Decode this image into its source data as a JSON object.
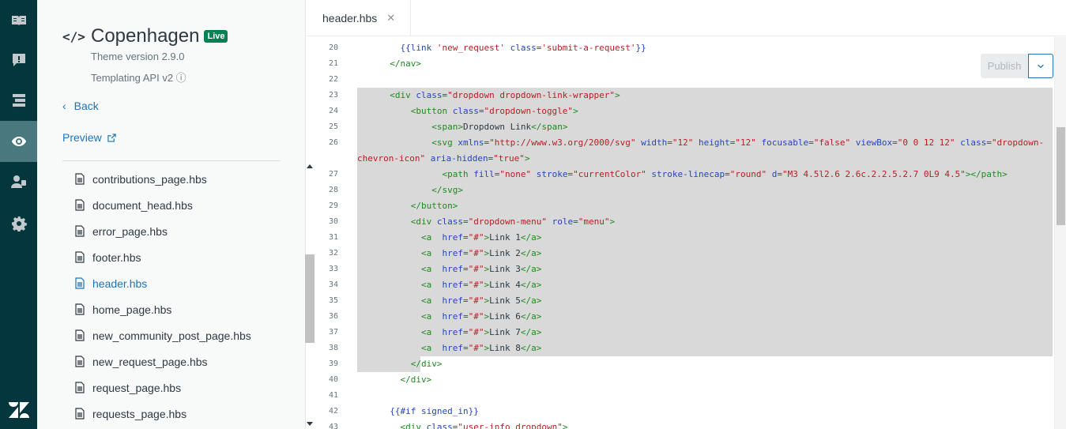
{
  "rail": {
    "items": [
      {
        "name": "guides-icon"
      },
      {
        "name": "alert-icon"
      },
      {
        "name": "arrange-icon"
      },
      {
        "name": "eye-icon",
        "active": true
      },
      {
        "name": "users-icon"
      },
      {
        "name": "gear-icon"
      }
    ],
    "logo": "zendesk-logo"
  },
  "theme": {
    "name": "Copenhagen",
    "badge": "Live",
    "version": "Theme version 2.9.0",
    "api": "Templating API v2 ⓘ"
  },
  "nav": {
    "back": "Back",
    "preview": "Preview"
  },
  "files": [
    "contributions_page.hbs",
    "document_head.hbs",
    "error_page.hbs",
    "footer.hbs",
    "header.hbs",
    "home_page.hbs",
    "new_community_post_page.hbs",
    "new_request_page.hbs",
    "request_page.hbs",
    "requests_page.hbs"
  ],
  "active_file": "header.hbs",
  "editor": {
    "tab_label": "header.hbs",
    "publish_label": "Publish",
    "lines": [
      {
        "n": "20",
        "tokens": [
          [
            "    ",
            "text"
          ],
          [
            "{{link ",
            "hbs"
          ],
          [
            "'new_request'",
            "str"
          ],
          [
            " class=",
            "attr"
          ],
          [
            "'submit-a-request'",
            "str"
          ],
          [
            "}}",
            "hbs"
          ]
        ]
      },
      {
        "n": "21",
        "tokens": [
          [
            "  ",
            "text"
          ],
          [
            "</nav>",
            "tag"
          ]
        ]
      },
      {
        "n": "22",
        "tokens": []
      },
      {
        "n": "23",
        "tokens": [
          [
            "  ",
            "text"
          ],
          [
            "<div",
            "tag"
          ],
          [
            " class=",
            "attr"
          ],
          [
            "\"dropdown dropdown-link-wrapper\"",
            "str"
          ],
          [
            ">",
            "tag"
          ]
        ]
      },
      {
        "n": "24",
        "tokens": [
          [
            "      ",
            "text"
          ],
          [
            "<button",
            "tag"
          ],
          [
            " class=",
            "attr"
          ],
          [
            "\"dropdown-toggle\"",
            "str"
          ],
          [
            ">",
            "tag"
          ]
        ]
      },
      {
        "n": "25",
        "tokens": [
          [
            "          ",
            "text"
          ],
          [
            "<span>",
            "tag"
          ],
          [
            "Dropdown Link",
            "text"
          ],
          [
            "</span>",
            "tag"
          ]
        ]
      },
      {
        "n": "26",
        "tokens": [
          [
            "          ",
            "text"
          ],
          [
            "<svg",
            "tag"
          ],
          [
            " xmlns=",
            "attr"
          ],
          [
            "\"http://www.w3.org/2000/svg\"",
            "str"
          ],
          [
            " width=",
            "attr"
          ],
          [
            "\"12\"",
            "str"
          ],
          [
            " height=",
            "attr"
          ],
          [
            "\"12\"",
            "str"
          ],
          [
            " focusable=",
            "attr"
          ],
          [
            "\"false\"",
            "str"
          ],
          [
            " viewBox=",
            "attr"
          ],
          [
            "\"0 0 12 12\"",
            "str"
          ],
          [
            " class=",
            "attr"
          ],
          [
            "\"dropdown-",
            "str"
          ]
        ]
      },
      {
        "n": "",
        "tokens": [
          [
            "chevron-icon\"",
            "str"
          ],
          [
            " aria-hidden=",
            "attr"
          ],
          [
            "\"true\"",
            "str"
          ],
          [
            ">",
            "tag"
          ]
        ],
        "wrap": true
      },
      {
        "n": "27",
        "tokens": [
          [
            "            ",
            "text"
          ],
          [
            "<path",
            "tag"
          ],
          [
            " fill=",
            "attr"
          ],
          [
            "\"none\"",
            "str"
          ],
          [
            " stroke=",
            "attr"
          ],
          [
            "\"currentColor\"",
            "str"
          ],
          [
            " stroke-linecap=",
            "attr"
          ],
          [
            "\"round\"",
            "str"
          ],
          [
            " d=",
            "attr"
          ],
          [
            "\"M3 4.5l2.6 2.6c.2.2.5.2.7 0L9 4.5\"",
            "str"
          ],
          [
            "></path>",
            "tag"
          ]
        ]
      },
      {
        "n": "28",
        "tokens": [
          [
            "          ",
            "text"
          ],
          [
            "</svg>",
            "tag"
          ]
        ]
      },
      {
        "n": "29",
        "tokens": [
          [
            "      ",
            "text"
          ],
          [
            "</button>",
            "tag"
          ]
        ]
      },
      {
        "n": "30",
        "tokens": [
          [
            "      ",
            "text"
          ],
          [
            "<div",
            "tag"
          ],
          [
            " class=",
            "attr"
          ],
          [
            "\"dropdown-menu\"",
            "str"
          ],
          [
            " role=",
            "attr"
          ],
          [
            "\"menu\"",
            "str"
          ],
          [
            ">",
            "tag"
          ]
        ]
      },
      {
        "n": "31",
        "tokens": [
          [
            "        ",
            "text"
          ],
          [
            "<a",
            "tag"
          ],
          [
            "  href=",
            "attr"
          ],
          [
            "\"#\"",
            "str"
          ],
          [
            ">",
            "tag"
          ],
          [
            "Link 1",
            "text"
          ],
          [
            "</a>",
            "tag"
          ]
        ]
      },
      {
        "n": "32",
        "tokens": [
          [
            "        ",
            "text"
          ],
          [
            "<a",
            "tag"
          ],
          [
            "  href=",
            "attr"
          ],
          [
            "\"#\"",
            "str"
          ],
          [
            ">",
            "tag"
          ],
          [
            "Link 2",
            "text"
          ],
          [
            "</a>",
            "tag"
          ]
        ]
      },
      {
        "n": "33",
        "tokens": [
          [
            "        ",
            "text"
          ],
          [
            "<a",
            "tag"
          ],
          [
            "  href=",
            "attr"
          ],
          [
            "\"#\"",
            "str"
          ],
          [
            ">",
            "tag"
          ],
          [
            "Link 3",
            "text"
          ],
          [
            "</a>",
            "tag"
          ]
        ]
      },
      {
        "n": "34",
        "tokens": [
          [
            "        ",
            "text"
          ],
          [
            "<a",
            "tag"
          ],
          [
            "  href=",
            "attr"
          ],
          [
            "\"#\"",
            "str"
          ],
          [
            ">",
            "tag"
          ],
          [
            "Link 4",
            "text"
          ],
          [
            "</a>",
            "tag"
          ]
        ]
      },
      {
        "n": "35",
        "tokens": [
          [
            "        ",
            "text"
          ],
          [
            "<a",
            "tag"
          ],
          [
            "  href=",
            "attr"
          ],
          [
            "\"#\"",
            "str"
          ],
          [
            ">",
            "tag"
          ],
          [
            "Link 5",
            "text"
          ],
          [
            "</a>",
            "tag"
          ]
        ]
      },
      {
        "n": "36",
        "tokens": [
          [
            "        ",
            "text"
          ],
          [
            "<a",
            "tag"
          ],
          [
            "  href=",
            "attr"
          ],
          [
            "\"#\"",
            "str"
          ],
          [
            ">",
            "tag"
          ],
          [
            "Link 6",
            "text"
          ],
          [
            "</a>",
            "tag"
          ]
        ]
      },
      {
        "n": "37",
        "tokens": [
          [
            "        ",
            "text"
          ],
          [
            "<a",
            "tag"
          ],
          [
            "  href=",
            "attr"
          ],
          [
            "\"#\"",
            "str"
          ],
          [
            ">",
            "tag"
          ],
          [
            "Link 7",
            "text"
          ],
          [
            "</a>",
            "tag"
          ]
        ]
      },
      {
        "n": "38",
        "tokens": [
          [
            "        ",
            "text"
          ],
          [
            "<a",
            "tag"
          ],
          [
            "  href=",
            "attr"
          ],
          [
            "\"#\"",
            "str"
          ],
          [
            ">",
            "tag"
          ],
          [
            "Link 8",
            "text"
          ],
          [
            "</a>",
            "tag"
          ]
        ]
      },
      {
        "n": "39",
        "tokens": [
          [
            "      ",
            "text"
          ],
          [
            "</div>",
            "tag"
          ]
        ]
      },
      {
        "n": "40",
        "tokens": [
          [
            "    ",
            "text"
          ],
          [
            "</div>",
            "tag"
          ]
        ]
      },
      {
        "n": "41",
        "tokens": []
      },
      {
        "n": "42",
        "tokens": [
          [
            "  ",
            "text"
          ],
          [
            "{{#if signed_in}}",
            "hbs"
          ]
        ]
      },
      {
        "n": "43",
        "tokens": [
          [
            "    ",
            "text"
          ],
          [
            "<div",
            "tag"
          ],
          [
            " class=",
            "attr"
          ],
          [
            "\"user-info dropdown\"",
            "str"
          ],
          [
            ">",
            "tag"
          ]
        ]
      }
    ]
  },
  "colors": {
    "rail_bg": "#03363d",
    "accent": "#1f73b7",
    "live_badge": "#038153",
    "selection": "#d9d9d9"
  }
}
